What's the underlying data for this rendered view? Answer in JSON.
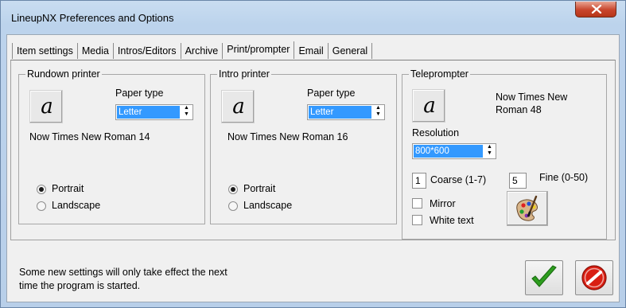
{
  "window": {
    "title": "LineupNX Preferences and Options"
  },
  "tabs": [
    {
      "label": "Item settings",
      "active": false
    },
    {
      "label": "Media",
      "active": false
    },
    {
      "label": "Intros/Editors",
      "active": false
    },
    {
      "label": "Archive",
      "active": false
    },
    {
      "label": "Print/prompter",
      "active": true
    },
    {
      "label": "Email",
      "active": false
    },
    {
      "label": "General",
      "active": false
    }
  ],
  "rundown_printer": {
    "title": "Rundown printer",
    "font_glyph": "a",
    "paper_type_label": "Paper type",
    "paper_type_value": "Letter",
    "font_name": "Now Times New Roman 14",
    "portrait_label": "Portrait",
    "landscape_label": "Landscape",
    "orientation": "Portrait"
  },
  "intro_printer": {
    "title": "Intro printer",
    "font_glyph": "a",
    "paper_type_label": "Paper type",
    "paper_type_value": "Letter",
    "font_name": "Now Times New Roman 16",
    "portrait_label": "Portrait",
    "landscape_label": "Landscape",
    "orientation": "Portrait"
  },
  "teleprompter": {
    "title": "Teleprompter",
    "font_glyph": "a",
    "font_name_line1": "Now Times New",
    "font_name_line2": "Roman 48",
    "resolution_label": "Resolution",
    "resolution_value": "800*600",
    "coarse_value": "1",
    "coarse_label": "Coarse (1-7)",
    "fine_value": "5",
    "fine_label": "Fine (0-50)",
    "mirror_label": "Mirror",
    "mirror_checked": false,
    "white_text_label": "White text",
    "white_text_checked": false
  },
  "status": {
    "line1": "Some new settings will only take effect the next",
    "line2": "time the program is started."
  },
  "colors": {
    "selection": "#3399ff",
    "ok_green": "#2e9e1f",
    "cancel_red": "#d91e12"
  }
}
